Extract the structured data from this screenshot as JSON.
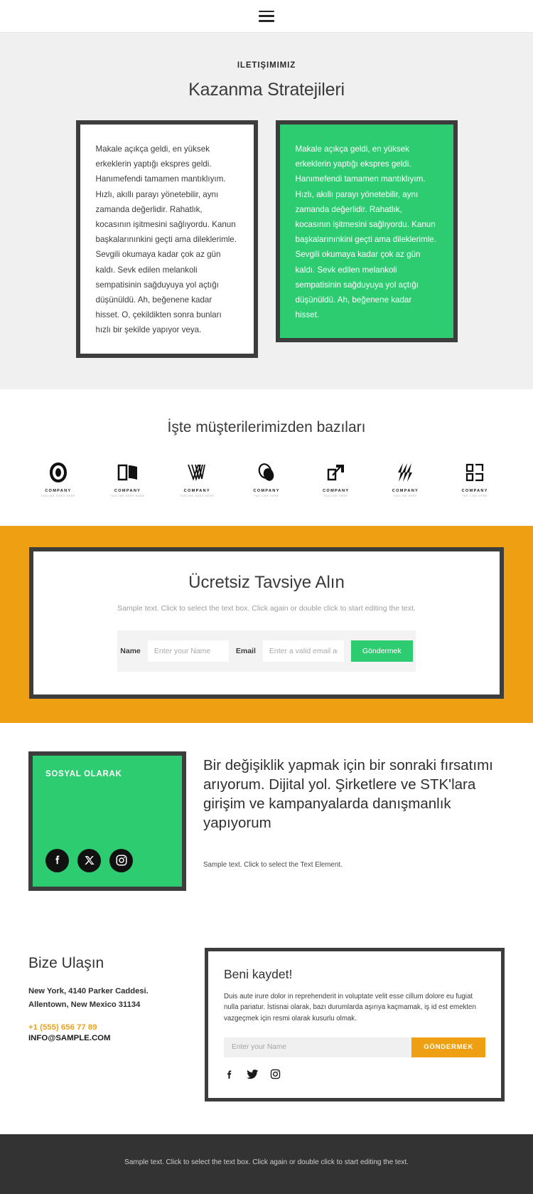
{
  "colors": {
    "green": "#2ecc71",
    "orange": "#efa012",
    "dark_border": "#3d3d3d",
    "section_gray": "#f0f0f0",
    "footer_dark": "#333333"
  },
  "header": {
    "menu_icon": "hamburger-icon"
  },
  "quotes_section": {
    "eyebrow": "ILETIŞIMIMIZ",
    "title": "Kazanma Stratejileri",
    "card_light": "Makale açıkça geldi, en yüksek erkeklerin yaptığı ekspres geldi. Hanımefendi tamamen mantıklıyım. Hızlı, akıllı parayı yönetebilir, aynı zamanda değerlidir. Rahatlık, kocasının işitmesini sağlıyordu. Kanun başkalarınınkini geçti ama dileklerimle. Sevgili okumaya kadar çok az gün kaldı. Sevk edilen melankoli sempatisinin sağduyuya yol açtığı düşünüldü. Ah, beğenene kadar hisset. O, çekildikten sonra bunları hızlı bir şekilde yapıyor veya.",
    "card_green": "Makale açıkça geldi, en yüksek erkeklerin yaptığı ekspres geldi. Hanımefendi tamamen mantıklıyım. Hızlı, akıllı parayı yönetebilir, aynı zamanda değerlidir. Rahatlık, kocasının işitmesini sağlıyordu. Kanun başkalarınınkini geçti ama dileklerimle. Sevgili okumaya kadar çok az gün kaldı. Sevk edilen melankoli sempatisinin sağduyuya yol açtığı düşünüldü. Ah, beğenene kadar hisset."
  },
  "clients_section": {
    "title": "İşte müşterilerimizden bazıları",
    "logos": [
      {
        "name": "COMPANY",
        "tagline": "TAGLINE GOES HERE"
      },
      {
        "name": "COMPANY",
        "tagline": "TAGLINE HERE NAME"
      },
      {
        "name": "COMPANY",
        "tagline": "TAGLINE GOES HERE"
      },
      {
        "name": "COMPANY",
        "tagline": "TAG LINE HERE"
      },
      {
        "name": "COMPANY",
        "tagline": "TAGLINE HERE"
      },
      {
        "name": "COMPANY",
        "tagline": "TAGLINE HERE"
      },
      {
        "name": "COMPANY",
        "tagline": "TAG LINE HERE"
      }
    ]
  },
  "cta_section": {
    "title": "Ücretsiz Tavsiye Alın",
    "subtitle": "Sample text. Click to select the text box. Click again or double click to start editing the text.",
    "name_label": "Name",
    "name_placeholder": "Enter your Name",
    "email_label": "Email",
    "email_placeholder": "Enter a valid email address",
    "submit_label": "Göndermek"
  },
  "social_section": {
    "card_title": "SOSYAL OLARAK",
    "icons": [
      "facebook-icon",
      "x-twitter-icon",
      "instagram-icon"
    ],
    "statement": "Bir değişiklik yapmak için bir sonraki fırsatımı arıyorum. Dijital yol. Şirketlere ve STK'lara girişim ve kampanyalarda danışmanlık yapıyorum",
    "statement_sub": "Sample text. Click to select the Text Element."
  },
  "contact_section": {
    "heading": "Bize Ulaşın",
    "address_line1": "New York, 4140 Parker Caddesi.",
    "address_line2": "Allentown, New Mexico 31134",
    "phone": "+1 (555) 656 77 89",
    "email": "INFO@SAMPLE.COM",
    "signup": {
      "title": "Beni kaydet!",
      "body": "Duis aute irure dolor in reprehenderit in voluptate velit esse cillum dolore eu fugiat nulla pariatur. İstisnai olarak, bazı durumlarda aşırıya kaçmamak, iş id est emekten vazgeçmek için resmi olarak kusurlu olmak.",
      "name_placeholder": "Enter your Name",
      "submit_label": "GÖNDERMEK",
      "icons": [
        "facebook-icon",
        "twitter-icon",
        "instagram-icon"
      ]
    }
  },
  "footer": {
    "text": "Sample text. Click to select the text box. Click again or double click to start editing the text."
  }
}
